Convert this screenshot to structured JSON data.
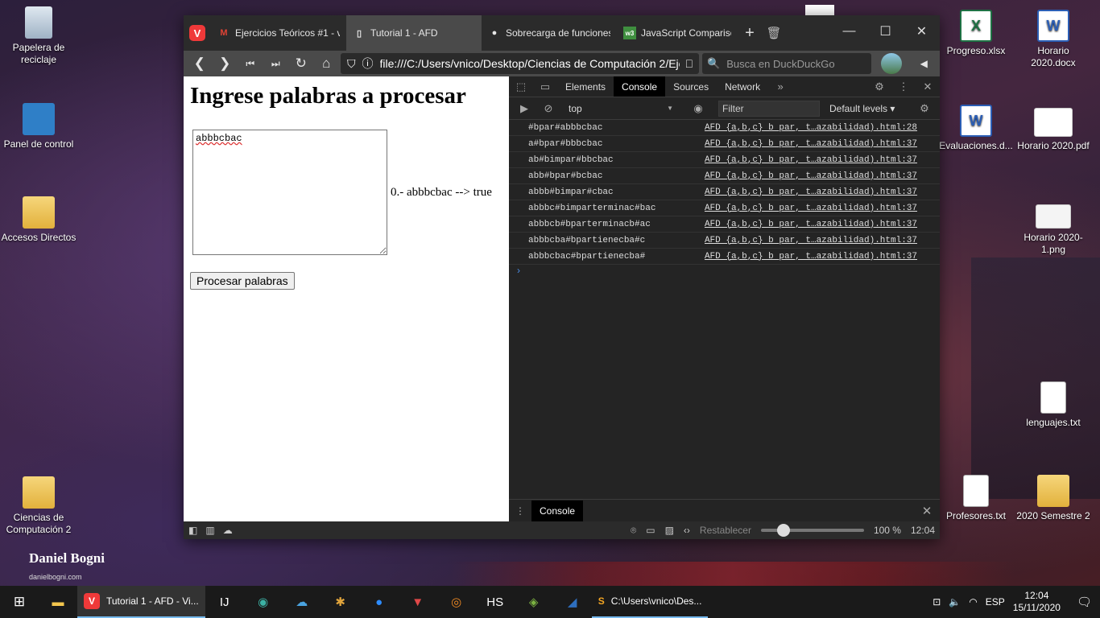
{
  "desktop": {
    "left_icons": [
      {
        "label": "Papelera de reciclaje",
        "icon": "recycle-bin-icon"
      },
      {
        "label": "Panel de control",
        "icon": "control-panel-icon"
      },
      {
        "label": "Accesos Directos",
        "icon": "folder-icon"
      },
      {
        "label": "Ciencias de Computación 2",
        "icon": "folder-icon"
      }
    ],
    "right_icons": [
      {
        "label": "Progreso.xlsx",
        "icon": "excel-icon"
      },
      {
        "label": "Horario 2020.docx",
        "icon": "word-icon"
      },
      {
        "label": "Evaluaciones.d...",
        "icon": "word-icon"
      },
      {
        "label": "Horario 2020.pdf",
        "icon": "pdf-icon"
      },
      {
        "label": "Horario 2020-1.png",
        "icon": "image-icon"
      },
      {
        "label": "lenguajes.txt",
        "icon": "text-file-icon"
      },
      {
        "label": "Profesores.txt",
        "icon": "text-file-icon"
      },
      {
        "label": "2020 Semestre 2",
        "icon": "folder-icon"
      }
    ],
    "brand_name": "Daniel Bogni",
    "brand_url": "danielbogni.com"
  },
  "browser": {
    "tabs": [
      {
        "label": "Ejercicios Teóricos #1 - v...",
        "icon": "gmail-icon",
        "active": false
      },
      {
        "label": "Tutorial 1 - AFD",
        "icon": "page-icon",
        "active": true
      },
      {
        "label": "Sobrecarga de funciones",
        "icon": "site-icon",
        "active": false
      },
      {
        "label": "JavaScript Comparison and",
        "icon": "site-icon",
        "active": false
      }
    ],
    "url": "file:///C:/Users/vnico/Desktop/Ciencias de Computación 2/Ejer...",
    "search_placeholder": "Busca en DuckDuckGo"
  },
  "page": {
    "heading": "Ingrese palabras a procesar",
    "textarea_value": "abbbcbac",
    "result_text": "0.- abbbcbac --> true",
    "process_button": "Procesar palabras"
  },
  "devtools": {
    "tabs": [
      "Elements",
      "Console",
      "Sources",
      "Network"
    ],
    "active_tab": "Console",
    "context": "top",
    "filter_placeholder": "Filter",
    "levels_label": "Default levels",
    "logs": [
      {
        "msg": "#bpar#abbbcbac",
        "src": "AFD {a,b,c} b par, t…azabilidad).html:28"
      },
      {
        "msg": "a#bpar#bbbcbac",
        "src": "AFD {a,b,c} b par, t…azabilidad).html:37"
      },
      {
        "msg": "ab#bimpar#bbcbac",
        "src": "AFD {a,b,c} b par, t…azabilidad).html:37"
      },
      {
        "msg": "abb#bpar#bcbac",
        "src": "AFD {a,b,c} b par, t…azabilidad).html:37"
      },
      {
        "msg": "abbb#bimpar#cbac",
        "src": "AFD {a,b,c} b par, t…azabilidad).html:37"
      },
      {
        "msg": "abbbc#bimparterminac#bac",
        "src": "AFD {a,b,c} b par, t…azabilidad).html:37"
      },
      {
        "msg": "abbbcb#bparterminacb#ac",
        "src": "AFD {a,b,c} b par, t…azabilidad).html:37"
      },
      {
        "msg": "abbbcba#bpartienecba#c",
        "src": "AFD {a,b,c} b par, t…azabilidad).html:37"
      },
      {
        "msg": "abbbcbac#bpartienecba#",
        "src": "AFD {a,b,c} b par, t…azabilidad).html:37"
      }
    ],
    "drawer_tab": "Console"
  },
  "statusbar": {
    "reset_label": "Restablecer",
    "zoom": "100 %",
    "time": "12:04"
  },
  "taskbar": {
    "active_app": "Tutorial 1 - AFD - Vi...",
    "sublime_app": "C:\\Users\\vnico\\Des...",
    "lang": "ESP",
    "time": "12:04",
    "date": "15/11/2020"
  }
}
